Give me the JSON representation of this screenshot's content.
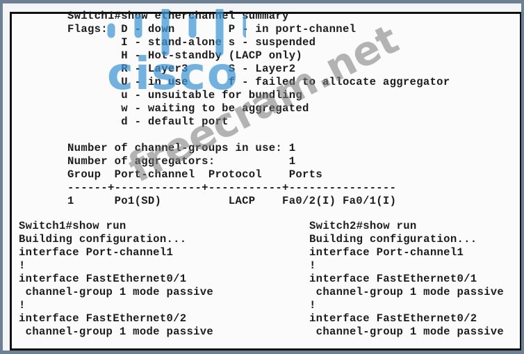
{
  "summary": {
    "lines": [
      "Switch1#show etherchannel summary",
      "Flags:  D - down        P - in port-channel",
      "        I - stand-alone s - suspended",
      "        H - Hot-standby (LACP only)",
      "        R - Layer3      S - Layer2",
      "        U - in use      f - failed to allocate aggregator",
      "        u - unsuitable for bundling",
      "        w - waiting to be aggregated",
      "        d - default port",
      "",
      "Number of channel-groups in use: 1",
      "Number of aggregators:           1",
      "Group  Port-channel  Protocol    Ports",
      "------+-------------+-----------+----------------",
      "1      Po1(SD)          LACP    Fa0/2(I) Fa0/1(I)"
    ]
  },
  "switch1_config": {
    "lines": [
      "Switch1#show run",
      "Building configuration...",
      "interface Port-channel1",
      "!",
      "interface FastEthernet0/1",
      " channel-group 1 mode passive",
      "!",
      "interface FastEthernet0/2",
      " channel-group 1 mode passive"
    ]
  },
  "switch2_config": {
    "lines": [
      "Switch2#show run",
      "Building configuration...",
      "interface Port-channel1",
      "!",
      "interface FastEthernet0/1",
      " channel-group 1 mode passive",
      "!",
      "interface FastEthernet0/2",
      " channel-group 1 mode passive"
    ]
  },
  "watermarks": {
    "logo": "cisco",
    "site": "freecram.net"
  },
  "colors": {
    "background": "#6e8194",
    "logo": "#3c96d7",
    "watermark": "#787878"
  }
}
